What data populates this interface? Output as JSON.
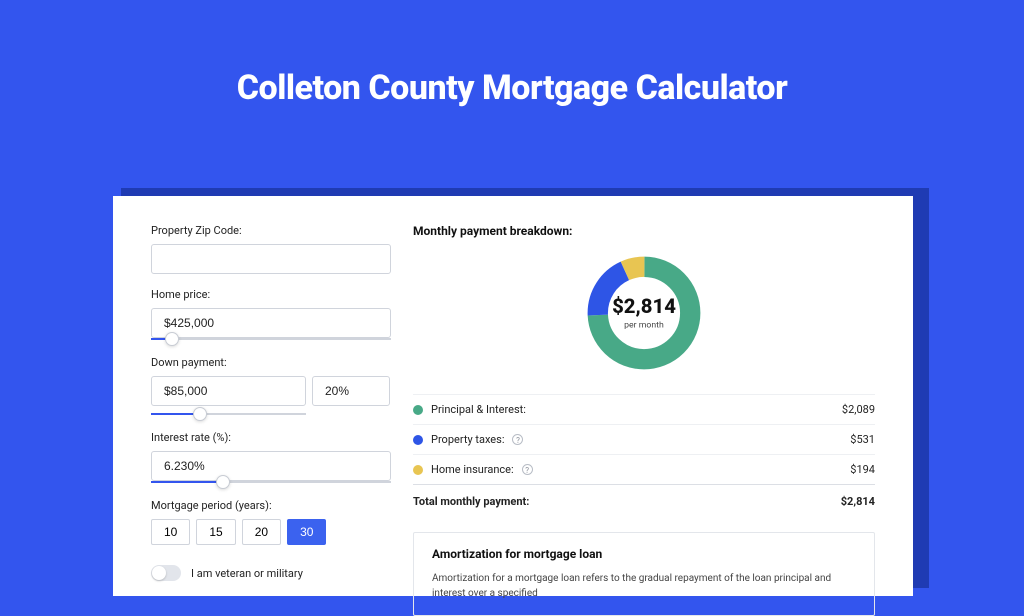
{
  "title": "Colleton County Mortgage Calculator",
  "form": {
    "zip_label": "Property Zip Code:",
    "zip_value": "",
    "home_price_label": "Home price:",
    "home_price_value": "$425,000",
    "down_payment_label": "Down payment:",
    "down_payment_value": "$85,000",
    "down_payment_pct": "20%",
    "interest_label": "Interest rate (%):",
    "interest_value": "6.230%",
    "period_label": "Mortgage period (years):",
    "period_options": [
      "10",
      "15",
      "20",
      "30"
    ],
    "period_selected": "30",
    "veteran_label": "I am veteran or military"
  },
  "breakdown": {
    "title": "Monthly payment breakdown:",
    "center_value": "$2,814",
    "center_unit": "per month",
    "items": [
      {
        "label": "Principal & Interest:",
        "value": "$2,089",
        "color": "green"
      },
      {
        "label": "Property taxes:",
        "value": "$531",
        "color": "blue",
        "help": true
      },
      {
        "label": "Home insurance:",
        "value": "$194",
        "color": "yellow",
        "help": true
      }
    ],
    "total_label": "Total monthly payment:",
    "total_value": "$2,814"
  },
  "amort": {
    "title": "Amortization for mortgage loan",
    "text": "Amortization for a mortgage loan refers to the gradual repayment of the loan principal and interest over a specified"
  },
  "chart_data": {
    "type": "pie",
    "title": "Monthly payment breakdown",
    "series": [
      {
        "name": "Principal & Interest",
        "value": 2089,
        "color": "#48a987"
      },
      {
        "name": "Property taxes",
        "value": 531,
        "color": "#2e55e6"
      },
      {
        "name": "Home insurance",
        "value": 194,
        "color": "#e8c552"
      }
    ],
    "total": 2814,
    "unit": "USD/month"
  }
}
